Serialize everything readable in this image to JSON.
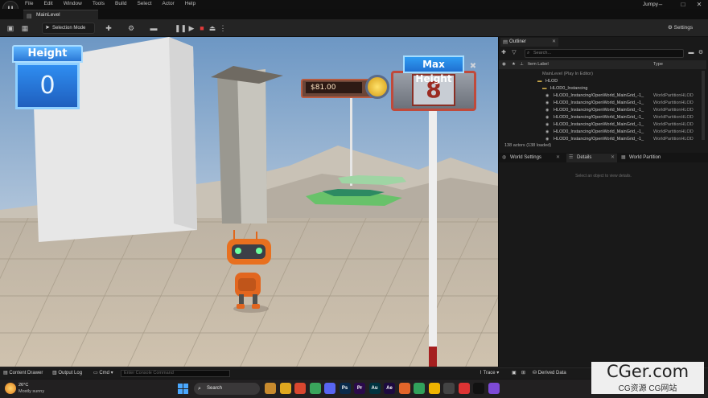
{
  "app": {
    "menu": [
      "File",
      "Edit",
      "Window",
      "Tools",
      "Build",
      "Select",
      "Actor",
      "Help"
    ],
    "project_name": "Jumpy",
    "level_tab": "MainLevel",
    "logo_glyph": "U"
  },
  "toolbar": {
    "selection_mode": "Selection Mode",
    "settings": "Settings"
  },
  "hud": {
    "height_label": "Height",
    "height_value": "0",
    "max_height_label": "Max Height",
    "max_height_value": "8",
    "money": "$81.00"
  },
  "outliner": {
    "tab_label": "Outliner",
    "search_placeholder": "Search...",
    "col_label": "Item Label",
    "col_type": "Type",
    "rows": [
      {
        "label": "MainLevel (Play In Editor)",
        "type": ""
      },
      {
        "label": "HLOD",
        "type": ""
      },
      {
        "label": "HLOD0_Instancing",
        "type": ""
      },
      {
        "label": "HLOD0_Instancing/OpenWorld_MainGrid_-1_",
        "type": "WorldPartitionHLOD"
      },
      {
        "label": "HLOD0_Instancing/OpenWorld_MainGrid_-1_",
        "type": "WorldPartitionHLOD"
      },
      {
        "label": "HLOD0_Instancing/OpenWorld_MainGrid_-1_",
        "type": "WorldPartitionHLOD"
      },
      {
        "label": "HLOD0_Instancing/OpenWorld_MainGrid_-1_",
        "type": "WorldPartitionHLOD"
      },
      {
        "label": "HLOD0_Instancing/OpenWorld_MainGrid_-1_",
        "type": "WorldPartitionHLOD"
      },
      {
        "label": "HLOD0_Instancing/OpenWorld_MainGrid_-1_",
        "type": "WorldPartitionHLOD"
      },
      {
        "label": "HLOD0_Instancing/OpenWorld_MainGrid_-1_",
        "type": "WorldPartitionHLOD"
      }
    ],
    "count": "138 actors (138 loaded)"
  },
  "details": {
    "tabs": [
      "World Settings",
      "Details",
      "World Partition"
    ],
    "hint": "Select an object to view details."
  },
  "bottombar": {
    "content_drawer": "Content Drawer",
    "output_log": "Output Log",
    "cmd": "Cmd",
    "console_placeholder": "Enter Console Command",
    "trace": "Trace",
    "derived_data": "Derived Data"
  },
  "taskbar": {
    "temperature": "26°C",
    "weather": "Mostly sunny",
    "search": "Search",
    "apps": [
      {
        "glyph": "",
        "color": "#c98b2e"
      },
      {
        "glyph": "",
        "color": "#e0a81f"
      },
      {
        "glyph": "",
        "color": "#d9472f"
      },
      {
        "glyph": "",
        "color": "#3aa55c"
      },
      {
        "glyph": "",
        "color": "#5865f2"
      },
      {
        "glyph": "Ps",
        "color": "#0a2a4a"
      },
      {
        "glyph": "Pr",
        "color": "#2a0a4a"
      },
      {
        "glyph": "Au",
        "color": "#00333f"
      },
      {
        "glyph": "Ae",
        "color": "#1c0a3f"
      },
      {
        "glyph": "",
        "color": "#e2662a"
      },
      {
        "glyph": "",
        "color": "#31a25b"
      },
      {
        "glyph": "",
        "color": "#f0b400"
      },
      {
        "glyph": "",
        "color": "#444"
      },
      {
        "glyph": "",
        "color": "#d33"
      },
      {
        "glyph": "",
        "color": "#111"
      },
      {
        "glyph": "",
        "color": "#7d4ad6"
      }
    ]
  },
  "watermark": {
    "big": "CGer.com",
    "small": "CG资源 CG网站"
  }
}
